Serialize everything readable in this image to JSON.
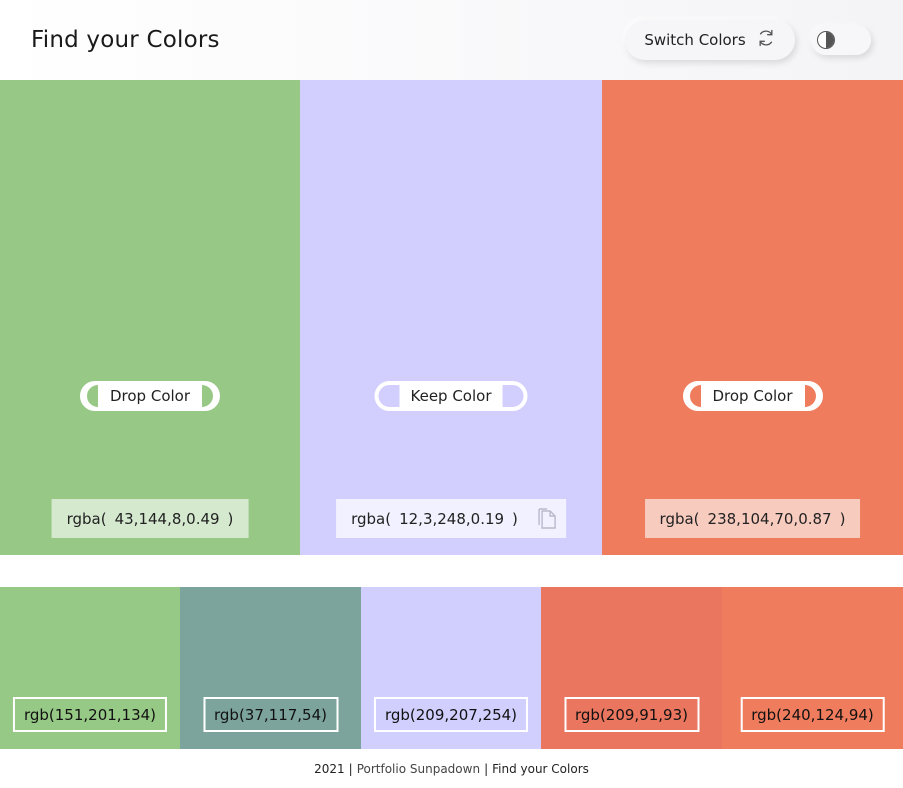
{
  "header": {
    "title": "Find your Colors",
    "switch_label": "Switch Colors",
    "switch_icon": "refresh-icon",
    "toggle_icon": "contrast-half-circle-icon"
  },
  "panels": [
    {
      "bg": "#98c886",
      "button_label": "Drop Color",
      "button_type": "drop",
      "value_prefix": "rgba(",
      "value": "43,144,8,0.49",
      "value_suffix": ")",
      "value_bg": "#d5e9cf"
    },
    {
      "bg": "#d2cfff",
      "button_label": "Keep Color",
      "button_type": "keep",
      "value_prefix": "rgba(",
      "value": "12,3,248,0.19",
      "value_suffix": ")",
      "value_bg": "#f1f1ff",
      "copy_icon": "copy-icon"
    },
    {
      "bg": "#f07c5e",
      "button_label": "Drop Color",
      "button_type": "drop",
      "value_prefix": "rgba(",
      "value": "238,104,70,0.87",
      "value_suffix": ")",
      "value_bg": "#f8cbbf"
    }
  ],
  "palette": [
    {
      "label": "rgb(151,201,134)",
      "color": "#97c986"
    },
    {
      "label": "rgb(37,117,54)",
      "color": "#7ca49d"
    },
    {
      "label": "rgb(209,207,254)",
      "color": "#d1cffe"
    },
    {
      "label": "rgb(209,91,93)",
      "color": "#eb765f"
    },
    {
      "label": "rgb(240,124,94)",
      "color": "#f07c5e"
    }
  ],
  "footer": {
    "year": "2021",
    "separator": "|",
    "link1": "Portfolio Sunpadown",
    "separator2": "|",
    "link2": "Find your Colors"
  }
}
